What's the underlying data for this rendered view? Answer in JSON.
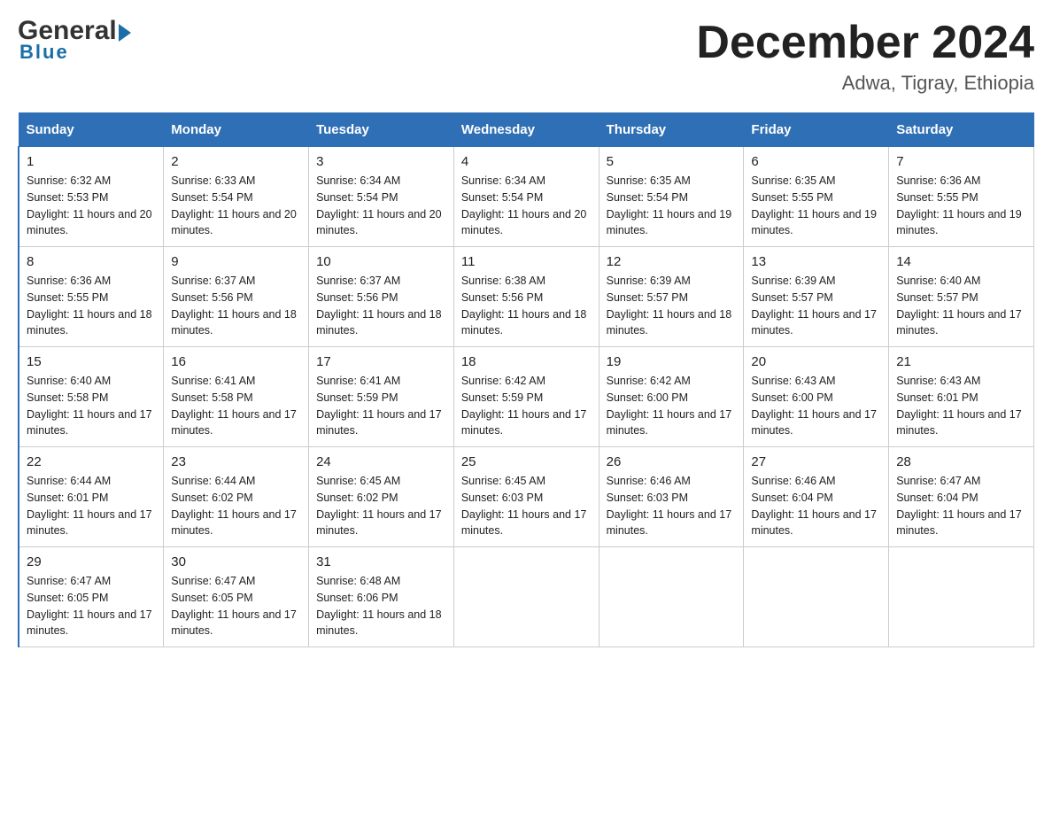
{
  "header": {
    "logo_general": "General",
    "logo_blue": "Blue",
    "month_title": "December 2024",
    "location": "Adwa, Tigray, Ethiopia"
  },
  "days_of_week": [
    "Sunday",
    "Monday",
    "Tuesday",
    "Wednesday",
    "Thursday",
    "Friday",
    "Saturday"
  ],
  "weeks": [
    [
      {
        "day": "1",
        "sunrise": "6:32 AM",
        "sunset": "5:53 PM",
        "daylight": "11 hours and 20 minutes."
      },
      {
        "day": "2",
        "sunrise": "6:33 AM",
        "sunset": "5:54 PM",
        "daylight": "11 hours and 20 minutes."
      },
      {
        "day": "3",
        "sunrise": "6:34 AM",
        "sunset": "5:54 PM",
        "daylight": "11 hours and 20 minutes."
      },
      {
        "day": "4",
        "sunrise": "6:34 AM",
        "sunset": "5:54 PM",
        "daylight": "11 hours and 20 minutes."
      },
      {
        "day": "5",
        "sunrise": "6:35 AM",
        "sunset": "5:54 PM",
        "daylight": "11 hours and 19 minutes."
      },
      {
        "day": "6",
        "sunrise": "6:35 AM",
        "sunset": "5:55 PM",
        "daylight": "11 hours and 19 minutes."
      },
      {
        "day": "7",
        "sunrise": "6:36 AM",
        "sunset": "5:55 PM",
        "daylight": "11 hours and 19 minutes."
      }
    ],
    [
      {
        "day": "8",
        "sunrise": "6:36 AM",
        "sunset": "5:55 PM",
        "daylight": "11 hours and 18 minutes."
      },
      {
        "day": "9",
        "sunrise": "6:37 AM",
        "sunset": "5:56 PM",
        "daylight": "11 hours and 18 minutes."
      },
      {
        "day": "10",
        "sunrise": "6:37 AM",
        "sunset": "5:56 PM",
        "daylight": "11 hours and 18 minutes."
      },
      {
        "day": "11",
        "sunrise": "6:38 AM",
        "sunset": "5:56 PM",
        "daylight": "11 hours and 18 minutes."
      },
      {
        "day": "12",
        "sunrise": "6:39 AM",
        "sunset": "5:57 PM",
        "daylight": "11 hours and 18 minutes."
      },
      {
        "day": "13",
        "sunrise": "6:39 AM",
        "sunset": "5:57 PM",
        "daylight": "11 hours and 17 minutes."
      },
      {
        "day": "14",
        "sunrise": "6:40 AM",
        "sunset": "5:57 PM",
        "daylight": "11 hours and 17 minutes."
      }
    ],
    [
      {
        "day": "15",
        "sunrise": "6:40 AM",
        "sunset": "5:58 PM",
        "daylight": "11 hours and 17 minutes."
      },
      {
        "day": "16",
        "sunrise": "6:41 AM",
        "sunset": "5:58 PM",
        "daylight": "11 hours and 17 minutes."
      },
      {
        "day": "17",
        "sunrise": "6:41 AM",
        "sunset": "5:59 PM",
        "daylight": "11 hours and 17 minutes."
      },
      {
        "day": "18",
        "sunrise": "6:42 AM",
        "sunset": "5:59 PM",
        "daylight": "11 hours and 17 minutes."
      },
      {
        "day": "19",
        "sunrise": "6:42 AM",
        "sunset": "6:00 PM",
        "daylight": "11 hours and 17 minutes."
      },
      {
        "day": "20",
        "sunrise": "6:43 AM",
        "sunset": "6:00 PM",
        "daylight": "11 hours and 17 minutes."
      },
      {
        "day": "21",
        "sunrise": "6:43 AM",
        "sunset": "6:01 PM",
        "daylight": "11 hours and 17 minutes."
      }
    ],
    [
      {
        "day": "22",
        "sunrise": "6:44 AM",
        "sunset": "6:01 PM",
        "daylight": "11 hours and 17 minutes."
      },
      {
        "day": "23",
        "sunrise": "6:44 AM",
        "sunset": "6:02 PM",
        "daylight": "11 hours and 17 minutes."
      },
      {
        "day": "24",
        "sunrise": "6:45 AM",
        "sunset": "6:02 PM",
        "daylight": "11 hours and 17 minutes."
      },
      {
        "day": "25",
        "sunrise": "6:45 AM",
        "sunset": "6:03 PM",
        "daylight": "11 hours and 17 minutes."
      },
      {
        "day": "26",
        "sunrise": "6:46 AM",
        "sunset": "6:03 PM",
        "daylight": "11 hours and 17 minutes."
      },
      {
        "day": "27",
        "sunrise": "6:46 AM",
        "sunset": "6:04 PM",
        "daylight": "11 hours and 17 minutes."
      },
      {
        "day": "28",
        "sunrise": "6:47 AM",
        "sunset": "6:04 PM",
        "daylight": "11 hours and 17 minutes."
      }
    ],
    [
      {
        "day": "29",
        "sunrise": "6:47 AM",
        "sunset": "6:05 PM",
        "daylight": "11 hours and 17 minutes."
      },
      {
        "day": "30",
        "sunrise": "6:47 AM",
        "sunset": "6:05 PM",
        "daylight": "11 hours and 17 minutes."
      },
      {
        "day": "31",
        "sunrise": "6:48 AM",
        "sunset": "6:06 PM",
        "daylight": "11 hours and 18 minutes."
      },
      null,
      null,
      null,
      null
    ]
  ]
}
